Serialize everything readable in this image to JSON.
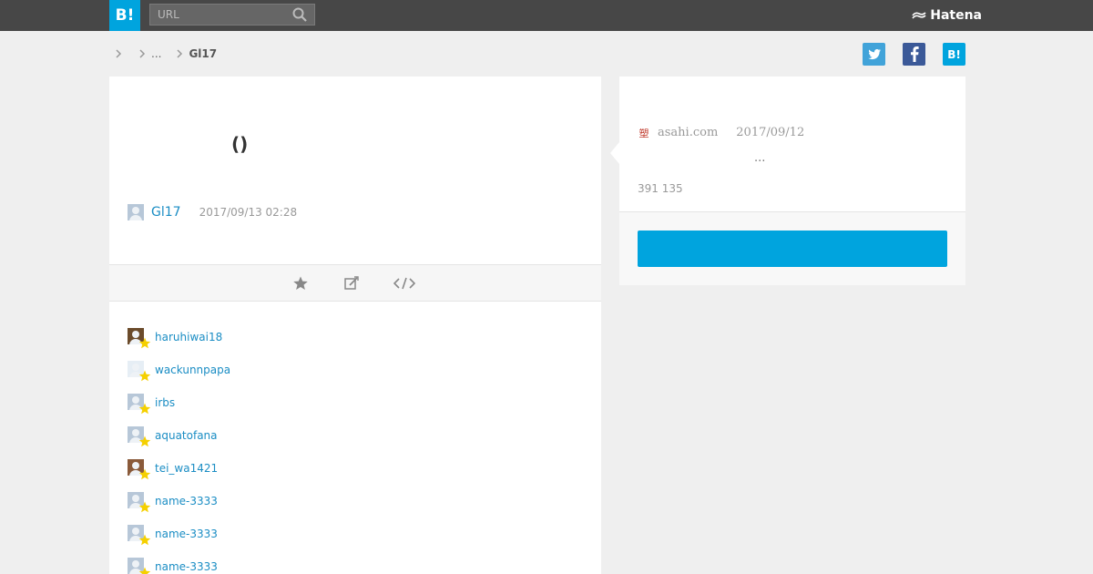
{
  "header": {
    "logo_text": "B!",
    "search_placeholder": "URL",
    "brand": "Hatena"
  },
  "breadcrumb": {
    "ellipsis": "...",
    "current": "Gl17"
  },
  "share": {
    "hatena_label": "B!"
  },
  "entry": {
    "title": "()",
    "user": "Gl17",
    "date": "2017/09/13 02:28"
  },
  "stars": [
    {
      "name": "haruhiwai18"
    },
    {
      "name": "wackunnpapa"
    },
    {
      "name": "irbs"
    },
    {
      "name": "aquatofana"
    },
    {
      "name": "tei_wa1421"
    },
    {
      "name": "name-3333"
    },
    {
      "name": "name-3333"
    },
    {
      "name": "name-3333"
    }
  ],
  "source": {
    "favicon_glyph": "塑",
    "site": "asahi.com",
    "date": "2017/09/12",
    "snippet": "...",
    "counts": "391 135"
  },
  "colors": {
    "topbar": "#474747",
    "accent": "#00a4de",
    "link": "#1a8dc4",
    "star": "#f5d000"
  }
}
